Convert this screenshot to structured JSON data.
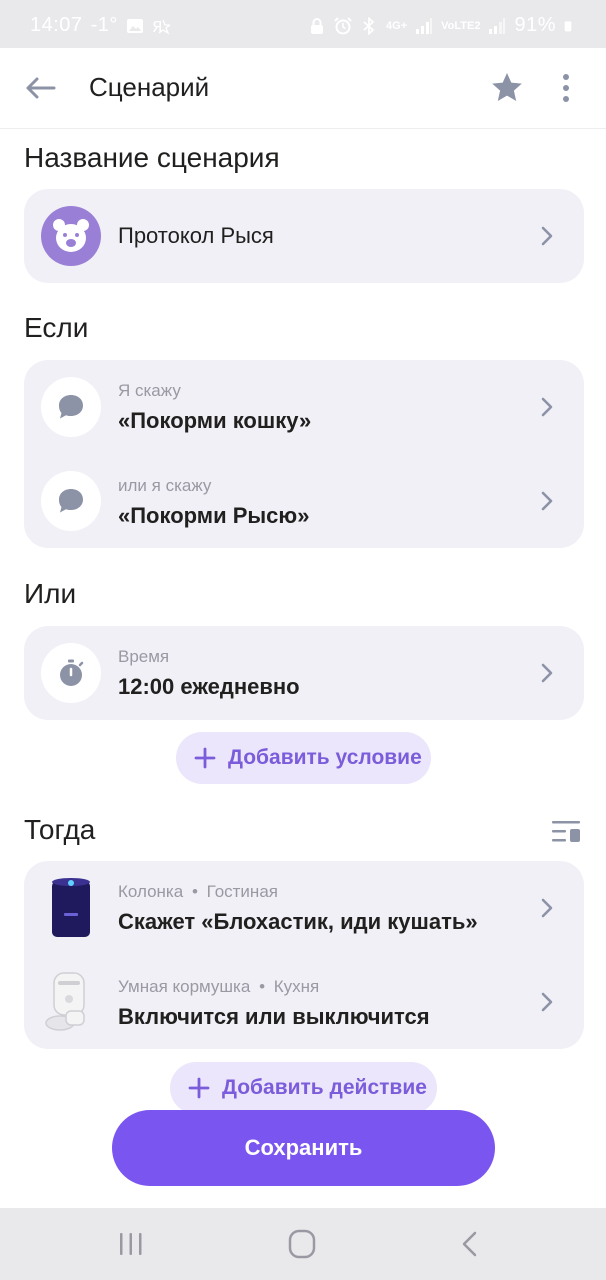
{
  "status_bar": {
    "time": "14:07",
    "temperature": "-1°",
    "battery": "91%",
    "network_label": "4G+",
    "volte_label": "VoLTE2"
  },
  "app_bar": {
    "title": "Сценарий",
    "back_icon": "arrow-left-icon",
    "star_icon": "star-icon",
    "more_icon": "more-vertical-icon"
  },
  "name_section": {
    "title": "Название сценария",
    "scenario_name": "Протокол Рыся",
    "icon": "bear-icon",
    "icon_bg": "#9a7fd6"
  },
  "if_section": {
    "title": "Если",
    "conditions": [
      {
        "label": "Я скажу",
        "value": "«Покорми кошку»",
        "icon": "speech-bubble-icon"
      },
      {
        "label": "или я скажу",
        "value": "«Покорми Рысю»",
        "icon": "speech-bubble-icon"
      }
    ]
  },
  "or_section": {
    "title": "Или",
    "conditions": [
      {
        "label": "Время",
        "value": "12:00 ежедневно",
        "icon": "stopwatch-icon"
      }
    ],
    "add_condition_label": "Добавить условие"
  },
  "then_section": {
    "title": "Тогда",
    "reorder_icon": "list-reorder-icon",
    "actions": [
      {
        "device": "Колонка",
        "room": "Гостиная",
        "value": "Скажет «Блохастик, иди кушать»",
        "icon": "smart-speaker-icon"
      },
      {
        "device": "Умная кормушка",
        "room": "Кухня",
        "value": "Включится или выключится",
        "icon": "pet-feeder-icon"
      }
    ],
    "separator": "•",
    "add_action_label": "Добавить действие"
  },
  "save_button": {
    "label": "Сохранить"
  },
  "colors": {
    "accent": "#7a55f0",
    "accent_soft": "#ebe6fb",
    "card_bg": "#f1f0f7",
    "secondary_text": "#9a99a3"
  }
}
